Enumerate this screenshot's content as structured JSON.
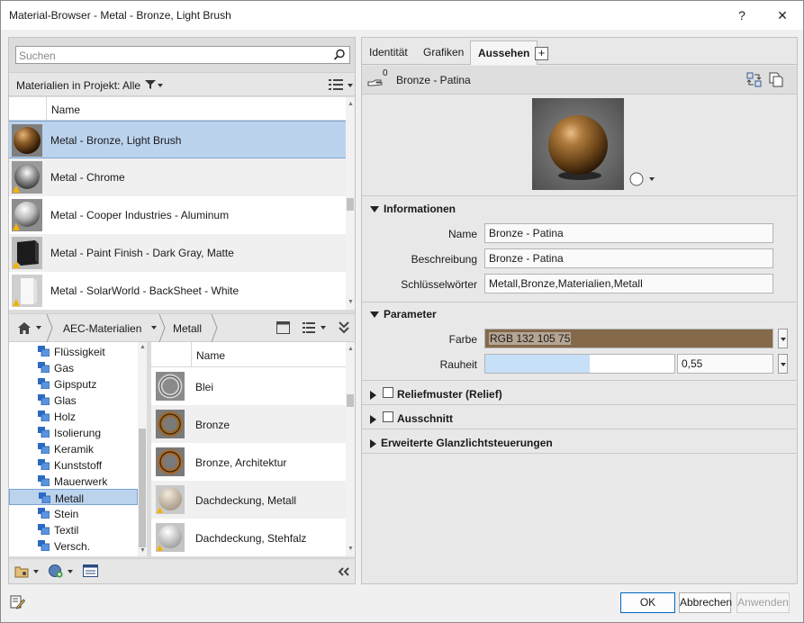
{
  "window": {
    "title": "Material-Browser - Metal - Bronze, Light Brush",
    "help_label": "?",
    "close_label": "✕"
  },
  "left": {
    "search_placeholder": "Suchen",
    "filter_label": "Materialien in Projekt: Alle",
    "column_name": "Name",
    "project_materials": [
      {
        "label": "Metal - Bronze, Light Brush",
        "thumb": "bronze-sphere",
        "selected": true,
        "warning": false
      },
      {
        "label": "Metal - Chrome",
        "thumb": "chrome-sphere",
        "selected": false,
        "warning": true
      },
      {
        "label": "Metal - Cooper Industries - Aluminum",
        "thumb": "aluminum-sphere",
        "selected": false,
        "warning": true
      },
      {
        "label": "Metal - Paint Finish - Dark Gray, Matte",
        "thumb": "dark-cube",
        "selected": false,
        "warning": true
      },
      {
        "label": "Metal - SolarWorld - BackSheet - White",
        "thumb": "white-panel",
        "selected": false,
        "warning": true
      }
    ],
    "breadcrumb": [
      "AEC-Materialien",
      "Metall"
    ],
    "tree": [
      {
        "label": "Flüssigkeit"
      },
      {
        "label": "Gas"
      },
      {
        "label": "Gipsputz"
      },
      {
        "label": "Glas"
      },
      {
        "label": "Holz"
      },
      {
        "label": "Isolierung"
      },
      {
        "label": "Keramik"
      },
      {
        "label": "Kunststoff"
      },
      {
        "label": "Mauerwerk"
      },
      {
        "label": "Metall",
        "selected": true
      },
      {
        "label": "Stein"
      },
      {
        "label": "Textil"
      },
      {
        "label": "Versch."
      }
    ],
    "library_column_name": "Name",
    "library_items": [
      {
        "label": "Blei",
        "thumb": "lead-ring"
      },
      {
        "label": "Bronze",
        "thumb": "bronze-ring"
      },
      {
        "label": "Bronze, Architektur",
        "thumb": "bronze-arch-ring"
      },
      {
        "label": "Dachdeckung, Metall",
        "thumb": "beige-sphere",
        "warning": true
      },
      {
        "label": "Dachdeckung, Stehfalz",
        "thumb": "light-sphere",
        "warning": true
      }
    ]
  },
  "right": {
    "tabs": [
      "Identität",
      "Grafiken",
      "Aussehen"
    ],
    "active_tab": "Aussehen",
    "plus_label": "+",
    "asset_count": "0",
    "asset_name": "Bronze - Patina",
    "informationen": {
      "title": "Informationen",
      "name_label": "Name",
      "name_value": "Bronze - Patina",
      "beschreibung_label": "Beschreibung",
      "beschreibung_value": "Bronze - Patina",
      "keywords_label": "Schlüsselwörter",
      "keywords_value": "Metall,Bronze,Materialien,Metall"
    },
    "parameter": {
      "title": "Parameter",
      "farbe_label": "Farbe",
      "farbe_value": "RGB 132 105 75",
      "farbe_color": "#84694b",
      "rauheit_label": "Rauheit",
      "rauheit_value": "0,55",
      "rauheit_fraction": 0.55
    },
    "relief_label": "Reliefmuster (Relief)",
    "ausschnitt_label": "Ausschnitt",
    "glanz_label": "Erweiterte Glanzlichtsteuerungen"
  },
  "footer": {
    "ok_label": "OK",
    "cancel_label": "Abbrechen",
    "apply_label": "Anwenden"
  }
}
